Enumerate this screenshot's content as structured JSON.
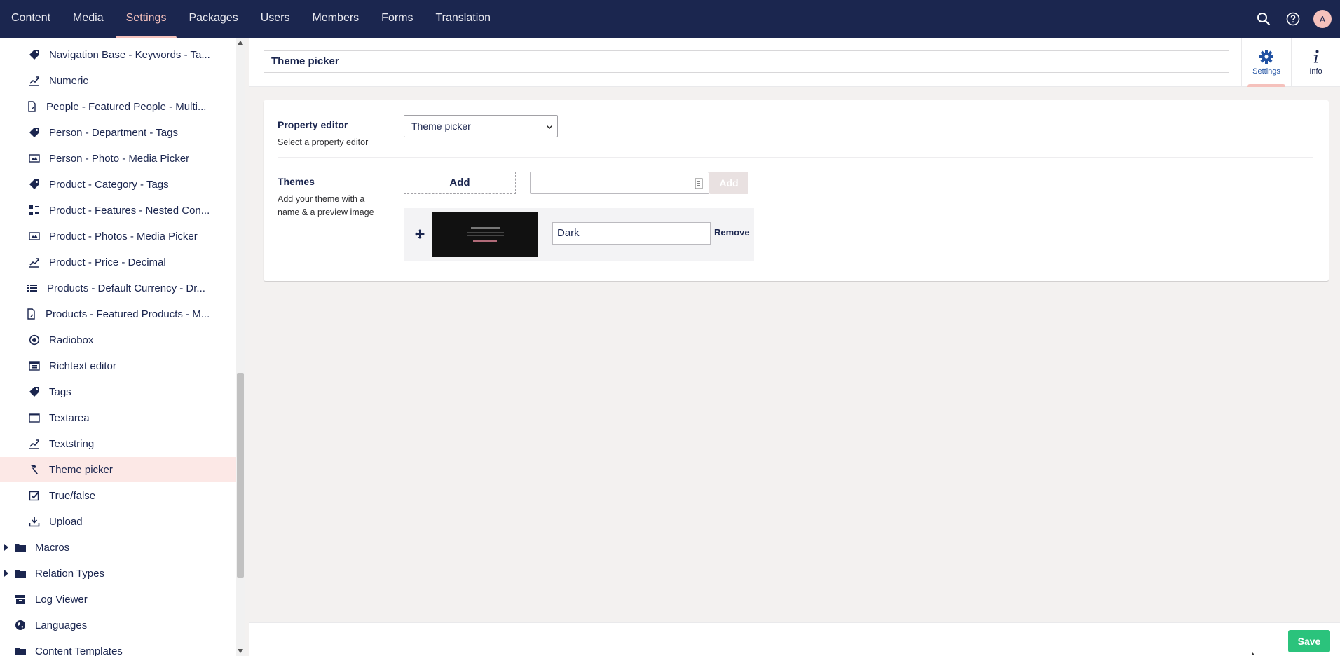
{
  "topnav": {
    "items": [
      {
        "label": "Content"
      },
      {
        "label": "Media"
      },
      {
        "label": "Settings"
      },
      {
        "label": "Packages"
      },
      {
        "label": "Users"
      },
      {
        "label": "Members"
      },
      {
        "label": "Forms"
      },
      {
        "label": "Translation"
      }
    ],
    "active": "Settings",
    "avatar_initial": "A"
  },
  "sidebar": {
    "items": [
      {
        "label": "Navigation Base - Keywords - Ta...",
        "icon": "tag-icon"
      },
      {
        "label": "Numeric",
        "icon": "chart-line-icon"
      },
      {
        "label": "People - Featured People - Multi...",
        "icon": "document-link-icon"
      },
      {
        "label": "Person - Department - Tags",
        "icon": "tag-icon"
      },
      {
        "label": "Person - Photo - Media Picker",
        "icon": "picture-icon"
      },
      {
        "label": "Product - Category - Tags",
        "icon": "tag-icon"
      },
      {
        "label": "Product - Features - Nested Con...",
        "icon": "grid-icon"
      },
      {
        "label": "Product - Photos - Media Picker",
        "icon": "picture-icon"
      },
      {
        "label": "Product - Price - Decimal",
        "icon": "chart-line-icon"
      },
      {
        "label": "Products - Default Currency - Dr...",
        "icon": "list-icon"
      },
      {
        "label": "Products - Featured Products - M...",
        "icon": "document-link-icon"
      },
      {
        "label": "Radiobox",
        "icon": "radio-icon"
      },
      {
        "label": "Richtext editor",
        "icon": "richtext-icon"
      },
      {
        "label": "Tags",
        "icon": "tag-icon"
      },
      {
        "label": "Textarea",
        "icon": "window-icon"
      },
      {
        "label": "Textstring",
        "icon": "chart-line-icon"
      },
      {
        "label": "Theme picker",
        "icon": "hammer-icon",
        "selected": true
      },
      {
        "label": "True/false",
        "icon": "checkbox-icon"
      },
      {
        "label": "Upload",
        "icon": "download-icon"
      },
      {
        "label": "Macros",
        "icon": "folder-icon",
        "expandable": true
      },
      {
        "label": "Relation Types",
        "icon": "folder-icon",
        "expandable": true
      },
      {
        "label": "Log Viewer",
        "icon": "archive-icon"
      },
      {
        "label": "Languages",
        "icon": "globe-icon"
      },
      {
        "label": "Content Templates",
        "icon": "folder-icon"
      }
    ]
  },
  "header": {
    "name_value": "Theme picker",
    "apps": [
      {
        "label": "Settings",
        "icon": "gear-icon",
        "active": true
      },
      {
        "label": "Info",
        "icon": "info-icon",
        "active": false
      }
    ]
  },
  "editor": {
    "property_editor": {
      "label": "Property editor",
      "description": "Select a property editor",
      "selected": "Theme picker"
    },
    "themes": {
      "label": "Themes",
      "description": "Add your theme with a name & a preview image",
      "add_label": "Add",
      "add_button_label": "Add",
      "items": [
        {
          "name": "Dark",
          "remove_label": "Remove"
        }
      ]
    }
  },
  "footer": {
    "save_label": "Save"
  },
  "colors": {
    "nav_bg": "#1b264f",
    "accent": "#f5c1bc",
    "save_green": "#2bc37c",
    "selected_bg": "#fce8e6"
  }
}
